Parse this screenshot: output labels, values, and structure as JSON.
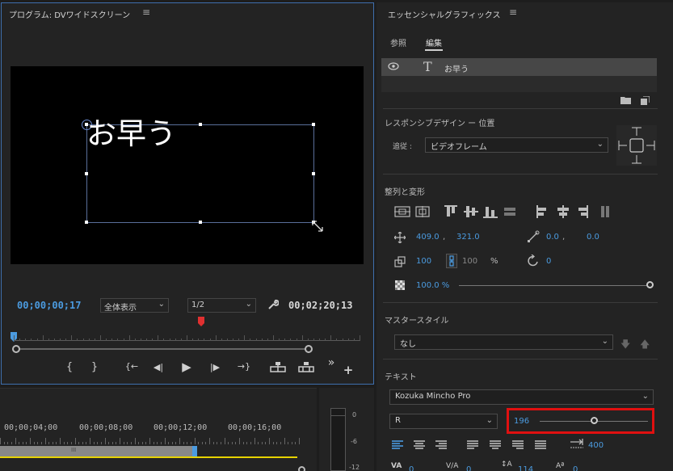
{
  "program_monitor": {
    "title": "プログラム: DVワイドスクリーン",
    "menu_icon": "hamburger-icon",
    "overlay_text": "お早う",
    "current_timecode": "00;00;00;17",
    "zoom_select": "全体表示",
    "resolution_select": "1/2",
    "duration_timecode": "00;02;20;13",
    "transport": {
      "mark_in": "{",
      "mark_out": "}",
      "go_to_in": "{←",
      "step_back": "◀|",
      "play": "▶",
      "step_forward": "|▶",
      "go_to_out": "→}",
      "more": "»",
      "add": "+"
    }
  },
  "timeline": {
    "times": [
      "00;00;04;00",
      "00;00;08;00",
      "00;00;12;00",
      "00;00;16;00"
    ],
    "clip_label": "III"
  },
  "audio_meter": {
    "ticks": [
      "0",
      "-6",
      "-12"
    ]
  },
  "essential_graphics": {
    "title": "エッセンシャルグラフィックス",
    "tabs": [
      {
        "label": "参照",
        "active": false
      },
      {
        "label": "編集",
        "active": true
      }
    ],
    "layer": {
      "name": "お早う",
      "icon": "text-T-icon"
    },
    "responsive": {
      "title": "レスポンシブデザイン ー 位置",
      "follow_label": "追従 :",
      "follow_value": "ビデオフレーム"
    },
    "align_transform": {
      "title": "整列と変形",
      "position_x": "409.0",
      "position_y": "321.0",
      "anchor_x": "0.0",
      "anchor_y": "0.0",
      "scale": "100",
      "scale_h": "100",
      "percent": "%",
      "rotation": "0",
      "opacity": "100.0 %",
      "opacity_fraction": 1.0
    },
    "master_style": {
      "title": "マスタースタイル",
      "value": "なし"
    },
    "text": {
      "title": "テキスト",
      "font": "Kozuka Mincho Pro",
      "style": "R",
      "font_size": "196",
      "font_size_fraction": 0.5,
      "tracking_value": "400",
      "row_values": [
        "0",
        "0",
        "114",
        "0"
      ]
    },
    "highlight_color": "#e01010"
  },
  "colors": {
    "accent": "#4b9be0",
    "panel_border": "#3f6fae",
    "playhead": "#e03030",
    "timeline_bar": "#e6d200"
  }
}
